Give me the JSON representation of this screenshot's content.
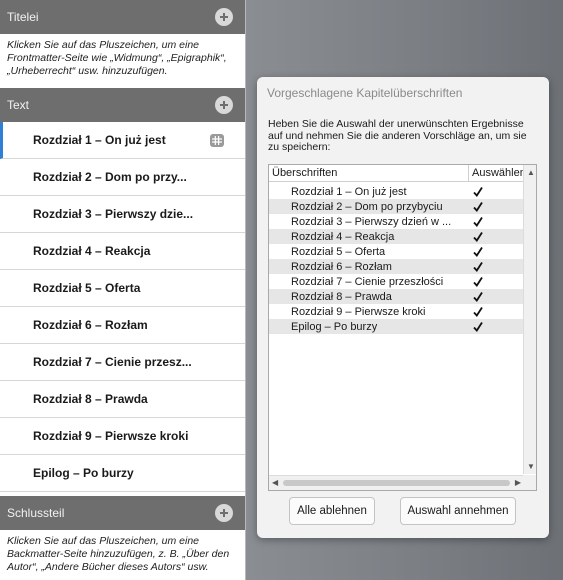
{
  "sidebar": {
    "front": {
      "title": "Titelei",
      "hint": "Klicken Sie auf das Pluszeichen, um eine Frontmatter-Seite wie „Widmung“, „Epigraphik“, „Urheberrecht“ usw. hinzuzufügen."
    },
    "text": {
      "title": "Text",
      "chapters": [
        "Rozdział 1 – On już jest",
        "Rozdział 2 – Dom po przy...",
        "Rozdział 3 – Pierwszy dzie...",
        "Rozdział 4 – Reakcja",
        "Rozdział 5 – Oferta",
        "Rozdział 6 – Rozłam",
        "Rozdział 7 – Cienie przesz...",
        "Rozdział 8 – Prawda",
        "Rozdział 9 – Pierwsze kroki",
        "Epilog – Po burzy"
      ],
      "active_index": 0
    },
    "back": {
      "title": "Schlussteil",
      "hint": "Klicken Sie auf das Pluszeichen, um eine Backmatter-Seite hinzuzufügen, z. B. „Über den Autor“, „Andere Bücher dieses Autors“ usw."
    }
  },
  "dialog": {
    "title": "Vorgeschlagene Kapitelüberschriften",
    "description": "Heben Sie die Auswahl der unerwünschten Ergebnisse auf und nehmen Sie die anderen Vorschläge an, um sie zu speichern:",
    "columns": [
      "Überschriften",
      "Auswählen"
    ],
    "rows": [
      {
        "label": "Rozdział 1 – On już jest",
        "checked": true
      },
      {
        "label": "Rozdział 2 – Dom po przybyciu",
        "checked": true
      },
      {
        "label": "Rozdział 3 – Pierwszy dzień w ...",
        "checked": true
      },
      {
        "label": "Rozdział 4 – Reakcja",
        "checked": true
      },
      {
        "label": "Rozdział 5 – Oferta",
        "checked": true
      },
      {
        "label": "Rozdział 6 – Rozłam",
        "checked": true
      },
      {
        "label": "Rozdział 7 – Cienie przeszłości",
        "checked": true
      },
      {
        "label": "Rozdział 8 – Prawda",
        "checked": true
      },
      {
        "label": "Rozdział 9 – Pierwsze kroki",
        "checked": true
      },
      {
        "label": "Epilog – Po burzy",
        "checked": true
      }
    ],
    "reject_label": "Alle ablehnen",
    "accept_label": "Auswahl annehmen"
  },
  "colors": {
    "section_header": "#6e6e6e",
    "active_accent": "#2f7fd6",
    "backdrop": "#80858b"
  },
  "icons": {
    "add": "plus-circle-icon",
    "chapter_menu": "grid-icon",
    "check": "checkmark-icon"
  }
}
